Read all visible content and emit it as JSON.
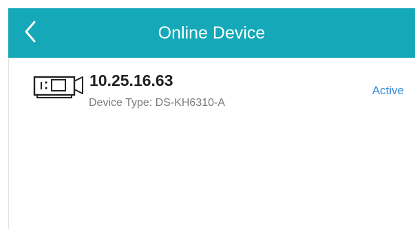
{
  "header": {
    "title": "Online Device",
    "back_icon": "chevron-left-icon",
    "bg_color": "#14a8b8"
  },
  "devices": [
    {
      "icon": "camera-device-icon",
      "ip": "10.25.16.63",
      "device_type": "Device Type: DS-KH6310-A",
      "status": "Active",
      "status_color": "#3a8ad8"
    }
  ]
}
